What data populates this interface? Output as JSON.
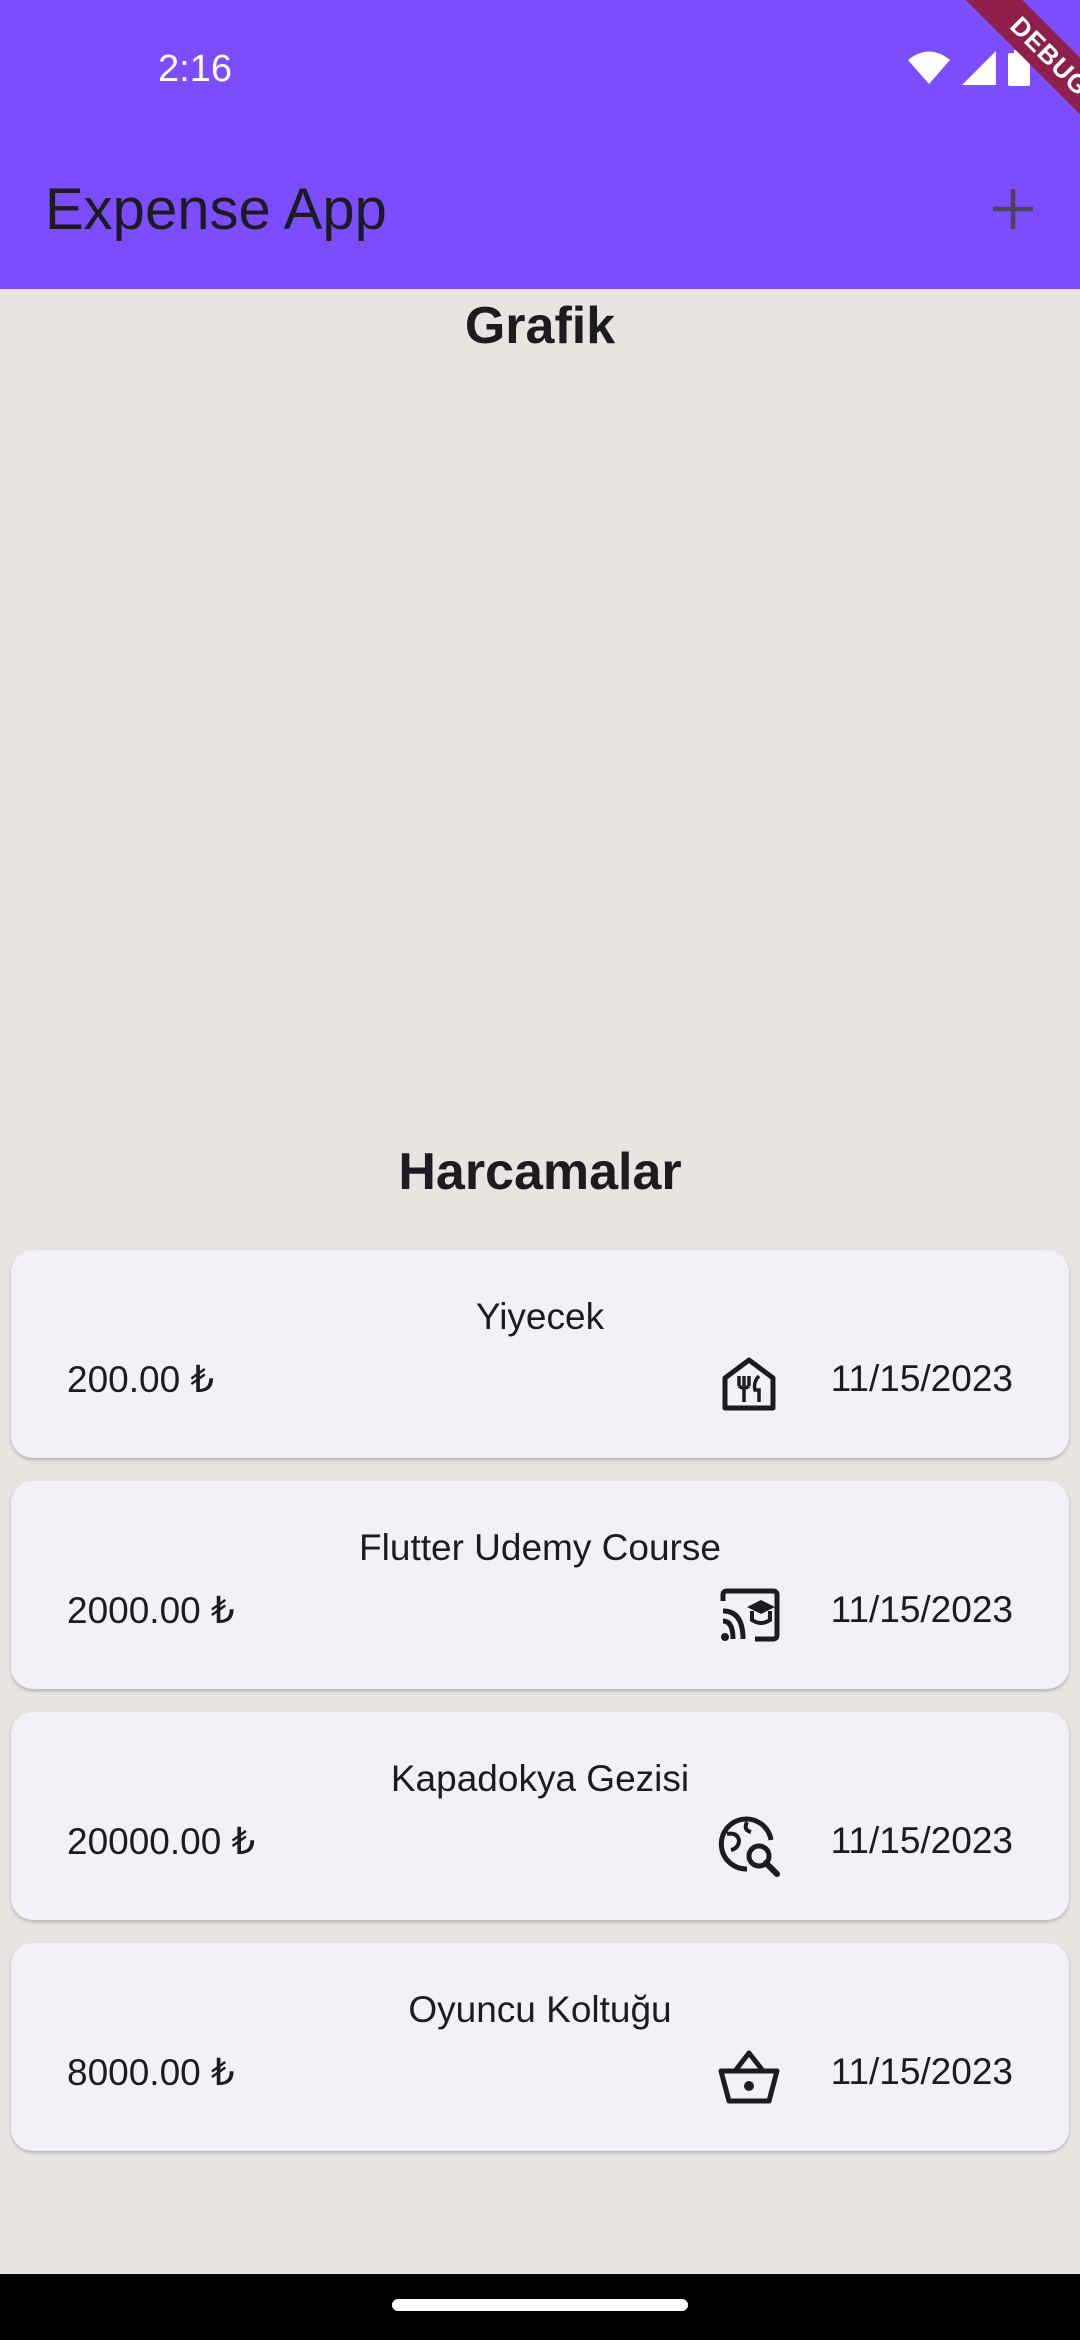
{
  "status_bar": {
    "time": "2:16",
    "icons": [
      "wifi-icon",
      "cellular-signal-icon",
      "battery-icon"
    ]
  },
  "app_bar": {
    "title": "Expense App",
    "action_icon": "add-icon",
    "background_color": "#7c4dff"
  },
  "debug_banner": {
    "label": "DEBUG",
    "color": "#8e1f4a"
  },
  "chart_section": {
    "title": "Grafik"
  },
  "expenses_section": {
    "title": "Harcamalar",
    "items": [
      {
        "title": "Yiyecek",
        "amount": "200.00 ₺",
        "date": "11/15/2023",
        "icon": "restaurant-icon"
      },
      {
        "title": "Flutter Udemy Course",
        "amount": "2000.00 ₺",
        "date": "11/15/2023",
        "icon": "cast-for-education-icon"
      },
      {
        "title": "Kapadokya Gezisi",
        "amount": "20000.00 ₺",
        "date": "11/15/2023",
        "icon": "travel-explore-icon"
      },
      {
        "title": "Oyuncu Koltuğu",
        "amount": "8000.00 ₺",
        "date": "11/15/2023",
        "icon": "shopping-basket-icon"
      }
    ]
  },
  "colors": {
    "page_background": "#e7e4e2",
    "card_background": "#f4f0f7"
  }
}
